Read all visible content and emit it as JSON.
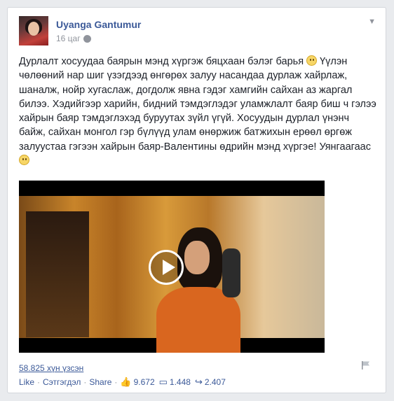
{
  "post": {
    "author": "Uyanga Gantumur",
    "time": "16 цаг",
    "text_parts": [
      "Дурлалт хосуудаа баярын мэнд хүргэж бяцхаан бэлэг барья ",
      " Үүлэн чөлөөний нар шиг үзэгдээд өнгөрөх залуу насандаа дурлаж хайрлаж, шаналж, нойр хугаслаж, догдолж явна гэдэг хамгийн сайхан аз жаргал билээ. Хэдийгээр харийн, бидний тэмдэглэдэг уламжлалт баяр биш ч гэлээ хайрын баяр тэмдэглэхэд буруутах зүйл үгүй. Хосуудын дурлал үнэнч байж, сайхан монгол гэр бүлүүд улам өнөржиж батжихын ерөөл өргөж залуустаа гэгээн хайрын баяр-Валентины өдрийн мэнд хүргэе! Уянгаагаас "
    ],
    "views": "58.825 хүн үзсэн",
    "actions": {
      "like": "Like",
      "comment": "Сэтгэгдэл",
      "share": "Share",
      "likes_count": "9.672",
      "comments_count": "1.448",
      "shares_count": "2.407"
    }
  },
  "colors": {
    "link": "#3b5998",
    "text": "#1d2129",
    "muted": "#90949c"
  },
  "icons": [
    "globe-icon",
    "chevron-down-icon",
    "play-icon",
    "flag-icon",
    "like-icon",
    "comment-icon",
    "share-icon",
    "smiley-emoji"
  ]
}
